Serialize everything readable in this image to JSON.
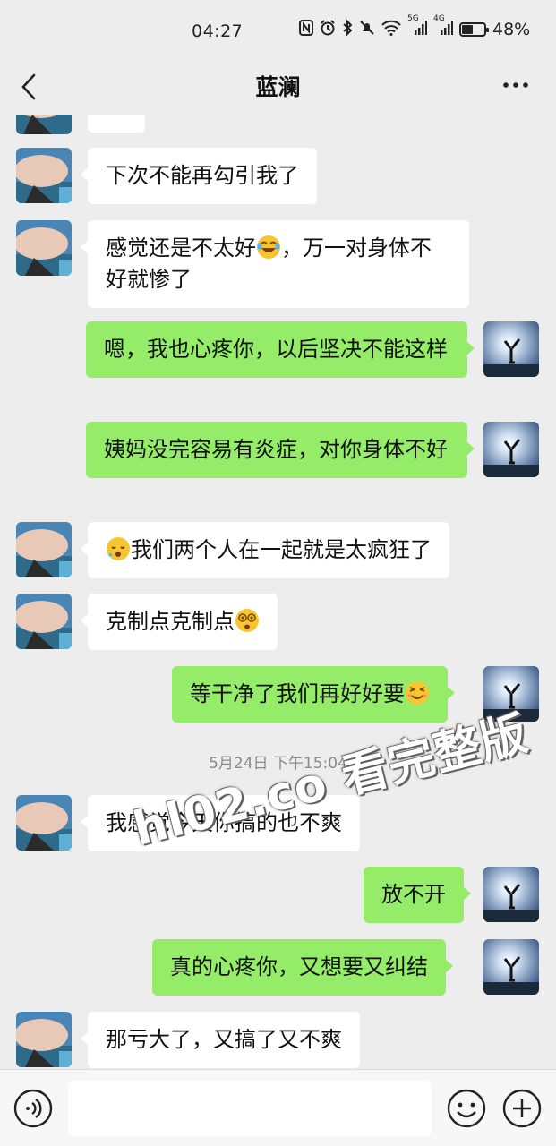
{
  "status_bar": {
    "time": "04:27",
    "icons": [
      "nfc-icon",
      "alarm-icon",
      "bluetooth-icon",
      "mute-icon",
      "wifi-icon",
      "signal-5g-icon",
      "signal-4g-icon"
    ],
    "signal_5g_label": "5G",
    "signal_4g_label": "4G",
    "battery_percent": "48%",
    "battery_level": 0.48
  },
  "header": {
    "title": "蓝澜"
  },
  "messages": [
    {
      "side": "in",
      "text": "下次不能再勾引我了"
    },
    {
      "side": "in",
      "text_before": "感觉还是不太好",
      "emoji": "laughing-tears-emoji",
      "text_after": "，万一对身体不好就惨了"
    },
    {
      "side": "out",
      "text": "嗯，我也心疼你，以后坚决不能这样"
    },
    {
      "side": "out",
      "text": "姨妈没完容易有炎症，对你身体不好"
    },
    {
      "side": "in",
      "emoji": "sleepy-face-emoji",
      "text_after": "我们两个人在一起就是太疯狂了"
    },
    {
      "side": "in",
      "text_before": "克制点克制点",
      "emoji": "dizzy-face-emoji"
    },
    {
      "side": "out",
      "text_before": "等干净了我们再好好要",
      "emoji": "smiling-closed-eyes-emoji"
    },
    {
      "side": "in",
      "text": "我感觉今天你搞的也不爽"
    },
    {
      "side": "out",
      "text": "放不开"
    },
    {
      "side": "out",
      "text": "真的心疼你，又想要又纠结"
    },
    {
      "side": "in",
      "text": "那亏大了，又搞了又不爽"
    }
  ],
  "timestamp": "5月24日 下午15:04",
  "watermark": "hl02.co 看完整版",
  "input_bar": {
    "placeholder": ""
  },
  "colors": {
    "background": "#ededed",
    "incoming_bubble": "#ffffff",
    "outgoing_bubble": "#95ec69",
    "timestamp_text": "#8a8a8a"
  }
}
